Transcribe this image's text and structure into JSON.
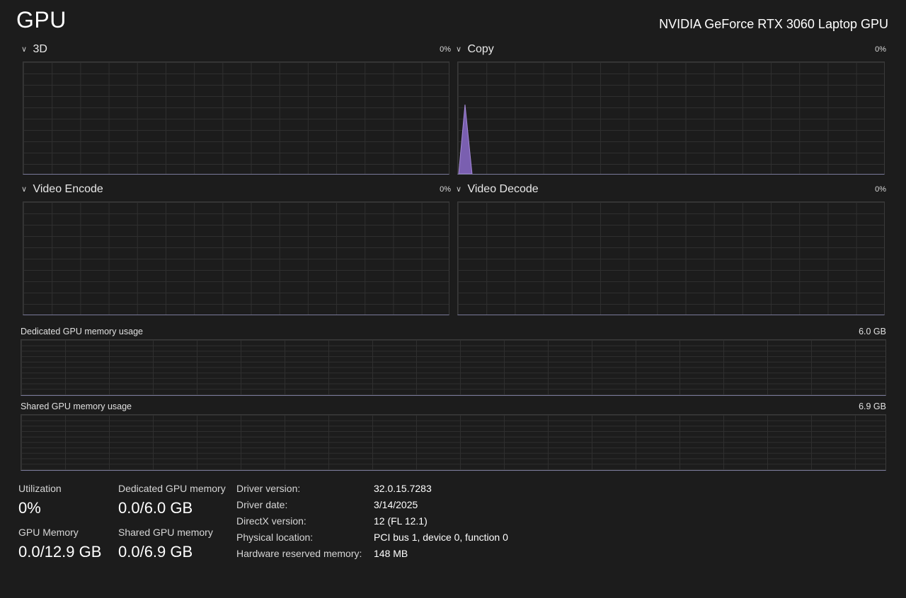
{
  "header": {
    "title": "GPU",
    "adapter": "NVIDIA GeForce RTX 3060 Laptop GPU"
  },
  "engines": [
    {
      "name": "3D",
      "value": "0%",
      "history": []
    },
    {
      "name": "Copy",
      "value": "0%",
      "history": [
        0.62,
        0,
        0
      ]
    },
    {
      "name": "Video Encode",
      "value": "0%",
      "history": []
    },
    {
      "name": "Video Decode",
      "value": "0%",
      "history": []
    }
  ],
  "memory_graphs": [
    {
      "name": "Dedicated GPU memory usage",
      "max": "6.0 GB"
    },
    {
      "name": "Shared GPU memory usage",
      "max": "6.9 GB"
    }
  ],
  "stats": {
    "utilization_label": "Utilization",
    "utilization_value": "0%",
    "gpu_memory_label": "GPU Memory",
    "gpu_memory_value": "0.0/12.9 GB",
    "dedicated_label": "Dedicated GPU memory",
    "dedicated_value": "0.0/6.0 GB",
    "shared_label": "Shared GPU memory",
    "shared_value": "0.0/6.9 GB"
  },
  "details": [
    {
      "label": "Driver version:",
      "value": "32.0.15.7283"
    },
    {
      "label": "Driver date:",
      "value": "3/14/2025"
    },
    {
      "label": "DirectX version:",
      "value": "12 (FL 12.1)"
    },
    {
      "label": "Physical location:",
      "value": "PCI bus 1, device 0, function 0"
    },
    {
      "label": "Hardware reserved memory:",
      "value": "148 MB"
    }
  ],
  "colors": {
    "background": "#1c1c1c",
    "graph_accent": "#9b7fd0",
    "graph_fill": "#7a5fb0"
  },
  "icons": {
    "collapse": "chevron-down-icon"
  }
}
